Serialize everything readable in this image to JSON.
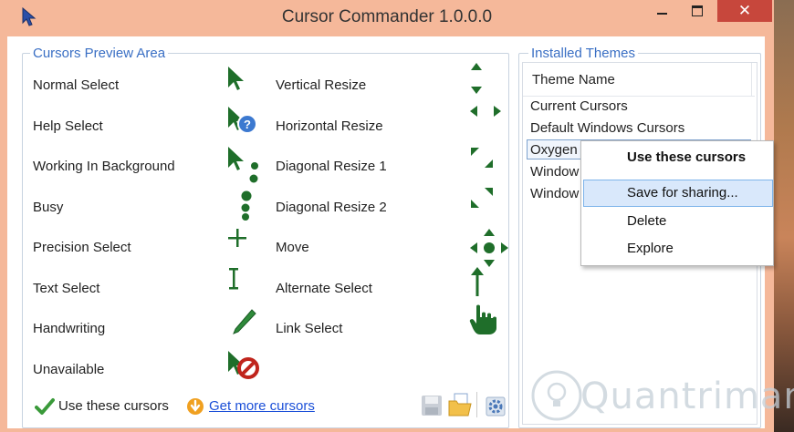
{
  "window": {
    "title": "Cursor Commander 1.0.0.0",
    "close_label": "✕"
  },
  "preview": {
    "legend": "Cursors Preview Area",
    "left_items": [
      "Normal Select",
      "Help Select",
      "Working In Background",
      "Busy",
      "Precision Select",
      "Text Select",
      "Handwriting",
      "Unavailable"
    ],
    "right_items": [
      "Vertical Resize",
      "Horizontal Resize",
      "Diagonal Resize 1",
      "Diagonal Resize 2",
      "Move",
      "Alternate Select",
      "Link Select"
    ]
  },
  "footer": {
    "use_label": "Use these cursors",
    "more_label": "Get more cursors"
  },
  "themes": {
    "legend": "Installed Themes",
    "column_header": "Theme Name",
    "rows": [
      "Current Cursors",
      "Default Windows Cursors",
      "Oxygen",
      "Window",
      "Window"
    ]
  },
  "context_menu": {
    "items": [
      "Use these cursors",
      "Save for sharing...",
      "Delete",
      "Explore"
    ]
  },
  "watermark": "Quantrimang",
  "colors": {
    "cursor_green": "#1f6e2a",
    "titlebar": "#f5b89a",
    "close": "#c7473c",
    "accent": "#3a6fc4"
  }
}
